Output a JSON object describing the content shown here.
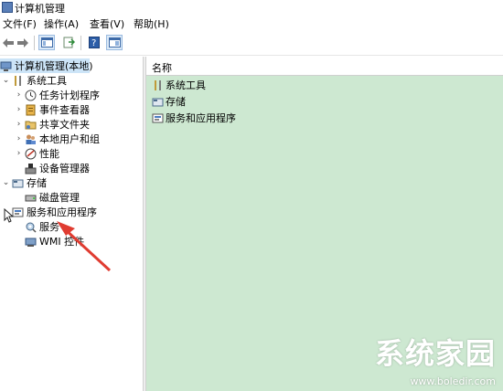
{
  "window": {
    "title": "计算机管理"
  },
  "menu": [
    "文件(F)",
    "操作(A)",
    "查看(V)",
    "帮助(H)"
  ],
  "toolbar": {
    "icons": [
      "back-arrow-icon",
      "forward-arrow-icon",
      "show-hide-tree-icon",
      "export-list-icon",
      "help-icon",
      "properties-icon"
    ]
  },
  "tree": {
    "root": "计算机管理(本地)",
    "system_tools": "系统工具",
    "task_scheduler": "任务计划程序",
    "event_viewer": "事件查看器",
    "shared_folders": "共享文件夹",
    "local_users_groups": "本地用户和组",
    "performance": "性能",
    "device_manager": "设备管理器",
    "storage": "存储",
    "disk_management": "磁盘管理",
    "services_apps": "服务和应用程序",
    "services": "服务",
    "wmi": "WMI 控件"
  },
  "content": {
    "column_header": "名称",
    "items": [
      "系统工具",
      "存储",
      "服务和应用程序"
    ]
  },
  "watermark": {
    "text": "系统家园",
    "url": "www.boledir.com"
  },
  "colors": {
    "content_bg": "#cde8d1",
    "selection": "#cce4f7",
    "annotation_arrow": "#e03c31"
  }
}
